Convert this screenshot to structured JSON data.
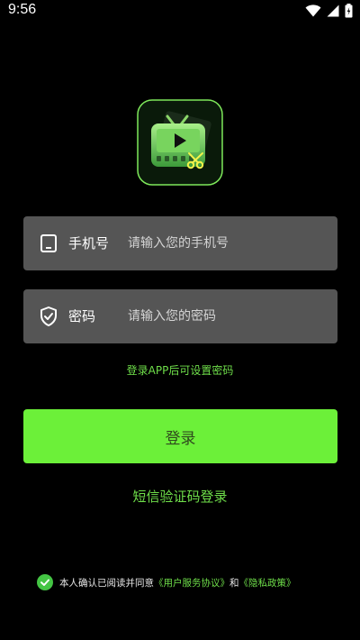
{
  "status_bar": {
    "time": "9:56",
    "icons": [
      "wifi-icon",
      "signal-icon",
      "battery-icon"
    ]
  },
  "app": {
    "logo_icon": "tv-video-scissors-logo"
  },
  "login_form": {
    "phone": {
      "label": "手机号",
      "placeholder": "请输入您的手机号",
      "value": "",
      "icon": "phone-icon"
    },
    "password": {
      "label": "密码",
      "placeholder": "请输入您的密码",
      "value": "",
      "icon": "shield-check-icon"
    },
    "hint": "登录APP后可设置密码",
    "login_button": "登录",
    "sms_login_link": "短信验证码登录"
  },
  "agreement": {
    "checked": true,
    "prefix": "本人确认已阅读并同意",
    "user_agreement": "《用户服务协议》",
    "conjunction": "和",
    "privacy_policy": "《隐私政策》"
  },
  "colors": {
    "background": "#000000",
    "accent": "#6cf039",
    "link": "#6fdf4a",
    "input_background": "#555555"
  }
}
